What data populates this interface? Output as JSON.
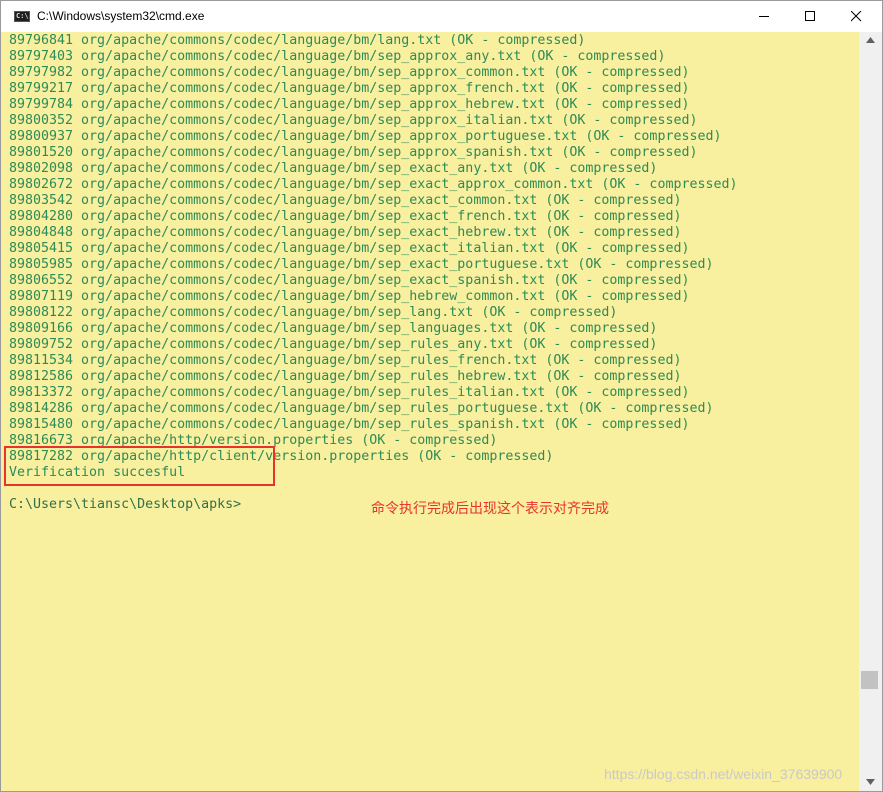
{
  "window": {
    "title": "C:\\Windows\\system32\\cmd.exe",
    "icon_text": "C:\\",
    "controls": {
      "minimize": "minimize-icon",
      "maximize": "maximize-icon",
      "close": "close-icon"
    }
  },
  "colors": {
    "console_bg": "#f8ef9f",
    "console_text": "#2e8b57",
    "annotation": "#e8322e"
  },
  "console": {
    "lines": [
      "89796841 org/apache/commons/codec/language/bm/lang.txt (OK - compressed)",
      "89797403 org/apache/commons/codec/language/bm/sep_approx_any.txt (OK - compressed)",
      "89797982 org/apache/commons/codec/language/bm/sep_approx_common.txt (OK - compressed)",
      "89799217 org/apache/commons/codec/language/bm/sep_approx_french.txt (OK - compressed)",
      "89799784 org/apache/commons/codec/language/bm/sep_approx_hebrew.txt (OK - compressed)",
      "89800352 org/apache/commons/codec/language/bm/sep_approx_italian.txt (OK - compressed)",
      "89800937 org/apache/commons/codec/language/bm/sep_approx_portuguese.txt (OK - compressed)",
      "89801520 org/apache/commons/codec/language/bm/sep_approx_spanish.txt (OK - compressed)",
      "89802098 org/apache/commons/codec/language/bm/sep_exact_any.txt (OK - compressed)",
      "89802672 org/apache/commons/codec/language/bm/sep_exact_approx_common.txt (OK - compressed)",
      "89803542 org/apache/commons/codec/language/bm/sep_exact_common.txt (OK - compressed)",
      "89804280 org/apache/commons/codec/language/bm/sep_exact_french.txt (OK - compressed)",
      "89804848 org/apache/commons/codec/language/bm/sep_exact_hebrew.txt (OK - compressed)",
      "89805415 org/apache/commons/codec/language/bm/sep_exact_italian.txt (OK - compressed)",
      "89805985 org/apache/commons/codec/language/bm/sep_exact_portuguese.txt (OK - compressed)",
      "89806552 org/apache/commons/codec/language/bm/sep_exact_spanish.txt (OK - compressed)",
      "89807119 org/apache/commons/codec/language/bm/sep_hebrew_common.txt (OK - compressed)",
      "89808122 org/apache/commons/codec/language/bm/sep_lang.txt (OK - compressed)",
      "89809166 org/apache/commons/codec/language/bm/sep_languages.txt (OK - compressed)",
      "89809752 org/apache/commons/codec/language/bm/sep_rules_any.txt (OK - compressed)",
      "89811534 org/apache/commons/codec/language/bm/sep_rules_french.txt (OK - compressed)",
      "89812586 org/apache/commons/codec/language/bm/sep_rules_hebrew.txt (OK - compressed)",
      "89813372 org/apache/commons/codec/language/bm/sep_rules_italian.txt (OK - compressed)",
      "89814286 org/apache/commons/codec/language/bm/sep_rules_portuguese.txt (OK - compressed)",
      "89815480 org/apache/commons/codec/language/bm/sep_rules_spanish.txt (OK - compressed)",
      "89816673 org/apache/http/version.properties (OK - compressed)",
      "89817282 org/apache/http/client/version.properties (OK - compressed)",
      "Verification succesful"
    ],
    "prompt": "C:\\Users\\tiansc\\Desktop\\apks>"
  },
  "annotation": {
    "text": "命令执行完成后出现这个表示对齐完成"
  },
  "watermark": "https://blog.csdn.net/weixin_37639900"
}
